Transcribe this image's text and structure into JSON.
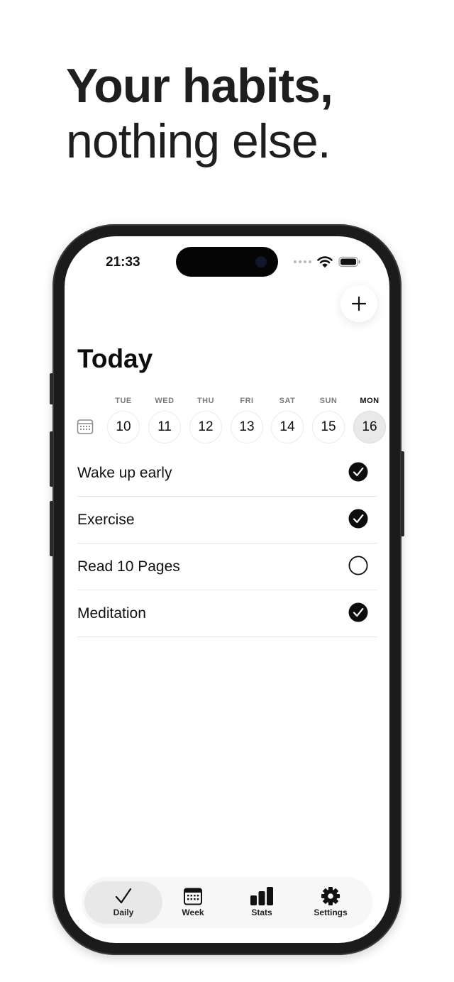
{
  "headline": {
    "line1": "Your habits,",
    "line2": "nothing else."
  },
  "status_bar": {
    "time": "21:33"
  },
  "screen": {
    "title": "Today"
  },
  "days": [
    {
      "name": "TUE",
      "date": "10",
      "selected": false
    },
    {
      "name": "WED",
      "date": "11",
      "selected": false
    },
    {
      "name": "THU",
      "date": "12",
      "selected": false
    },
    {
      "name": "FRI",
      "date": "13",
      "selected": false
    },
    {
      "name": "SAT",
      "date": "14",
      "selected": false
    },
    {
      "name": "SUN",
      "date": "15",
      "selected": false
    },
    {
      "name": "MON",
      "date": "16",
      "selected": true
    }
  ],
  "habits": [
    {
      "name": "Wake up early",
      "done": true
    },
    {
      "name": "Exercise",
      "done": true
    },
    {
      "name": "Read 10 Pages",
      "done": false
    },
    {
      "name": "Meditation",
      "done": true
    }
  ],
  "tabbar": {
    "tabs": [
      {
        "label": "Daily",
        "icon": "checkmark-icon",
        "active": true
      },
      {
        "label": "Week",
        "icon": "calendar-icon",
        "active": false
      },
      {
        "label": "Stats",
        "icon": "bar-chart-icon",
        "active": false
      },
      {
        "label": "Settings",
        "icon": "gear-icon",
        "active": false
      }
    ]
  },
  "colors": {
    "text": "#111111",
    "muted": "#7b7b7b",
    "selected_day_bg": "#e9e9e9",
    "tab_active_bg": "#e8e8e8",
    "tabbar_bg": "#f7f7f7",
    "phone_frame": "#1b1b1b"
  }
}
